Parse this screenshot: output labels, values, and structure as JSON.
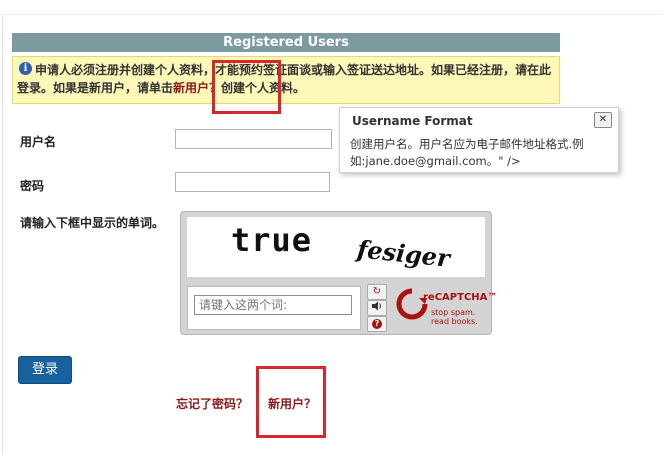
{
  "header": {
    "title": "Registered Users"
  },
  "notice": {
    "text_before": "申请人必须注册并创建个人资料，才能预约签证面谈或输入签证送达地址。如果已经注册，请在此登录。如果是新用户，请单击",
    "link": "新用户？",
    "text_after": "创建个人资料。"
  },
  "form": {
    "username_label": "用户名",
    "password_label": "密码",
    "captcha_label": "请输入下框中显示的单词。"
  },
  "tooltip": {
    "title": "Username Format",
    "close": "✕",
    "body": "创建用户名。用户名应为电子邮件地址格式.例如:jane.doe@gmail.com。\" />"
  },
  "captcha": {
    "word1": "true",
    "word2": "fesiger",
    "input_placeholder": "请键入这两个词:",
    "refresh_icon": "↻",
    "audio_icon": "🔊",
    "help_icon": "?",
    "brand": "reCAPTCHA™",
    "tagline_1": "stop spam.",
    "tagline_2": "read books."
  },
  "actions": {
    "login": "登录",
    "forgot_password": "忘记了密码？",
    "new_user": "新用户？"
  }
}
